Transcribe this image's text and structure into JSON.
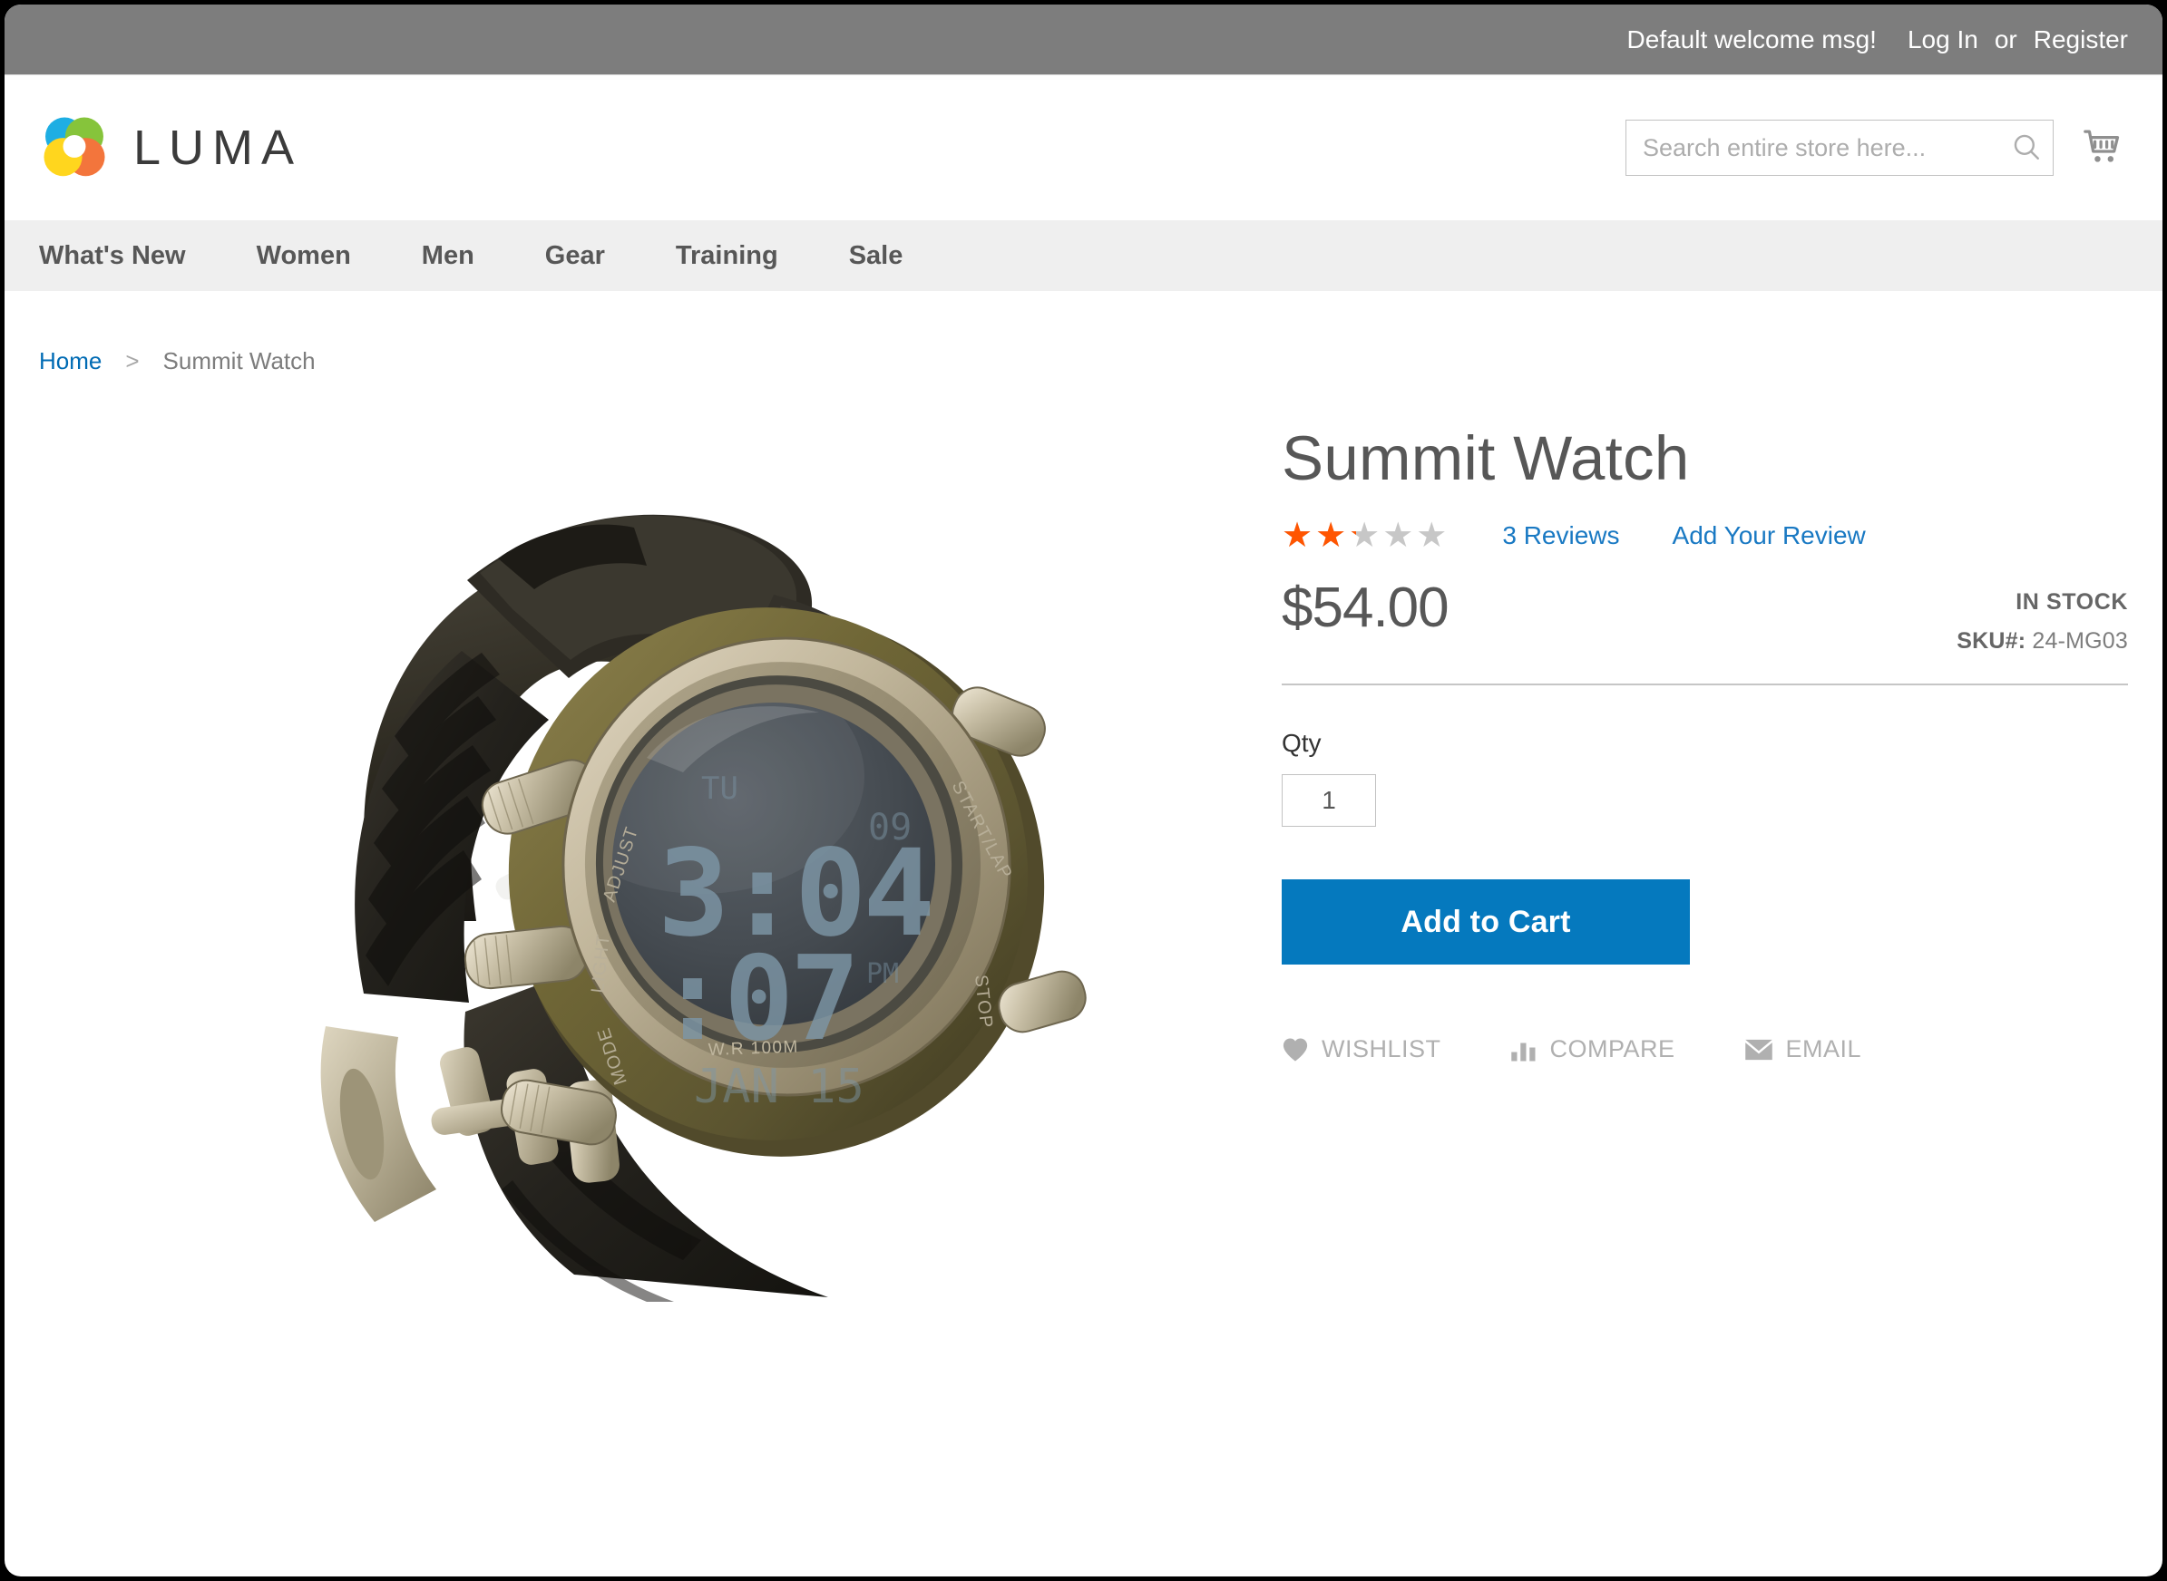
{
  "panel": {
    "welcome_message": "Default welcome msg!",
    "login_label": "Log In",
    "separator": "or",
    "register_label": "Register"
  },
  "header": {
    "logo_text": "LUMA",
    "logo_icon": "luma-flower-logo",
    "logo_colors": {
      "blue": "#00a3e0",
      "green": "#76bc21",
      "orange": "#f26322",
      "yellow": "#ffd100"
    },
    "search": {
      "placeholder": "Search entire store here...",
      "value": "",
      "icon": "search-icon"
    },
    "cart_icon": "shopping-cart-icon"
  },
  "nav": {
    "items": [
      {
        "label": "What's New"
      },
      {
        "label": "Women"
      },
      {
        "label": "Men"
      },
      {
        "label": "Gear"
      },
      {
        "label": "Training"
      },
      {
        "label": "Sale"
      }
    ]
  },
  "breadcrumb": {
    "home_label": "Home",
    "separator": ">",
    "current_label": "Summit Watch"
  },
  "product": {
    "title": "Summit Watch",
    "rating": {
      "value_percent": 44,
      "stars_glyphs": "★★★★★",
      "filled_color": "#ff5501",
      "empty_color": "#c7c7c7"
    },
    "reviews_link": "3 Reviews",
    "add_review_link": "Add Your Review",
    "price": "$54.00",
    "stock_status": "IN STOCK",
    "sku_label": "SKU#:",
    "sku_value": "24-MG03",
    "qty_label": "Qty",
    "qty_value": "1",
    "add_to_cart_label": "Add to Cart",
    "actions": [
      {
        "label": "WISHLIST",
        "icon": "heart-icon"
      },
      {
        "label": "COMPARE",
        "icon": "bar-chart-icon"
      },
      {
        "label": "EMAIL",
        "icon": "envelope-icon"
      }
    ],
    "image": {
      "name": "summit-watch-product-photo",
      "alt": "Summit Watch - black rubber strap digital sport watch",
      "display_time": "3:04",
      "bezel_labels": [
        "ADJUST",
        "LIGHT",
        "MODE",
        "START/LAP",
        "STOP",
        "W.R 100M"
      ]
    }
  },
  "theme": {
    "panel_bg": "#7d7d7d",
    "nav_bg": "#efefef",
    "link_blue": "#1979c3",
    "button_blue": "#0579be",
    "text_gray": "#575757",
    "star_orange": "#ff5501"
  }
}
